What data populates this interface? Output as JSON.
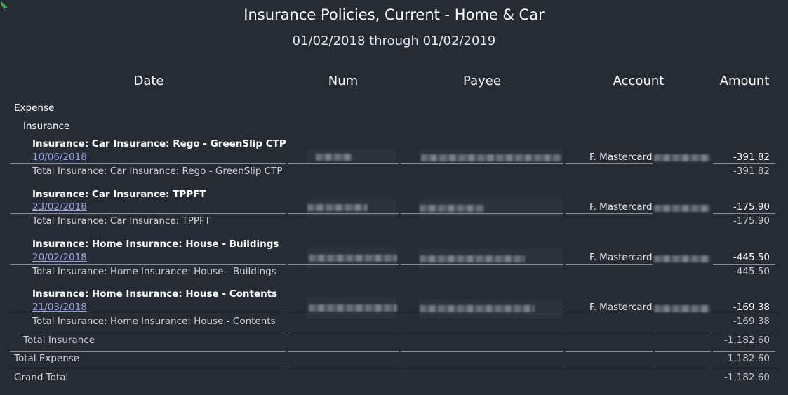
{
  "report": {
    "title": "Insurance Policies, Current - Home & Car",
    "date_range": "01/02/2018 through 01/02/2019"
  },
  "columns": {
    "date": "Date",
    "num": "Num",
    "payee": "Payee",
    "account": "Account",
    "amount": "Amount"
  },
  "groups": {
    "expense": "Expense",
    "insurance": "Insurance"
  },
  "sections": [
    {
      "header": "Insurance: Car Insurance: Rego - GreenSlip CTP",
      "date": "10/06/2018",
      "account": "F. Mastercard",
      "amount": "-391.82",
      "total_label": "Total Insurance: Car Insurance: Rego - GreenSlip CTP",
      "total": "-391.82"
    },
    {
      "header": "Insurance: Car Insurance: TPPFT",
      "date": "23/02/2018",
      "account": "F. Mastercard",
      "amount": "-175.90",
      "total_label": "Total Insurance: Car Insurance: TPPFT",
      "total": "-175.90"
    },
    {
      "header": "Insurance: Home Insurance: House - Buildings",
      "date": "20/02/2018",
      "account": "F. Mastercard",
      "amount": "-445.50",
      "total_label": "Total Insurance: Home Insurance: House - Buildings",
      "total": "-445.50"
    },
    {
      "header": "Insurance: Home Insurance: House - Contents",
      "date": "21/03/2018",
      "account": "F. Mastercard",
      "amount": "-169.38",
      "total_label": "Total Insurance: Home Insurance: House - Contents",
      "total": "-169.38"
    }
  ],
  "totals": {
    "insurance_label": "Total Insurance",
    "insurance": "-1,182.60",
    "expense_label": "Total Expense",
    "expense": "-1,182.60",
    "grand_label": "Grand Total",
    "grand": "-1,182.60"
  },
  "icons": {
    "corner": "green-arrow-icon"
  },
  "colors": {
    "background": "#272b33",
    "link": "#9aa4e8",
    "text": "#e6e7e9"
  }
}
